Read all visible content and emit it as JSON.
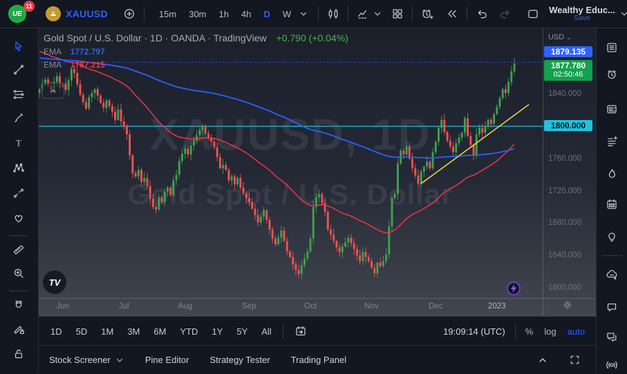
{
  "colors": {
    "accent_blue": "#2962ff",
    "up_green": "#3fa24e",
    "down_red": "#ef5350",
    "ema_fast_red": "#f23645",
    "ema_slow_blue": "#2962ff",
    "trend_yellow": "#e8d34d",
    "level_cyan": "#22c1dd",
    "last_green": "#13a14f"
  },
  "topbar": {
    "badge_count": "11",
    "symbol": "XAUUSD",
    "timeframes": [
      {
        "label": "15m",
        "active": false
      },
      {
        "label": "30m",
        "active": false
      },
      {
        "label": "1h",
        "active": false
      },
      {
        "label": "4h",
        "active": false
      },
      {
        "label": "D",
        "active": true
      },
      {
        "label": "W",
        "active": false
      }
    ],
    "account": {
      "name": "Wealthy Educ...",
      "action": "Save"
    }
  },
  "left_toolbar": {
    "tools": [
      "cursor",
      "trend-line",
      "fib-retracement",
      "brush",
      "text",
      "xabcd-pattern",
      "forecast",
      "emoji",
      "ruler",
      "zoom-in",
      "magnet",
      "drawing-lock",
      "lock"
    ]
  },
  "right_sidebar": {
    "icons": [
      "watchlist",
      "alerts",
      "news",
      "text-notes",
      "hotlists",
      "calendar",
      "ideas",
      "minds",
      "chat",
      "conversations",
      "streams"
    ]
  },
  "chart": {
    "legend": {
      "title": "Gold Spot / U.S. Dollar · 1D · OANDA · TradingView",
      "change": "+0.790 (+0.04%)",
      "ema_rows": [
        {
          "label": "EMA",
          "value": "1772.797"
        },
        {
          "label": "EMA",
          "value": "1787.215"
        }
      ]
    },
    "watermark": {
      "line1": "XAUUSD, 1D",
      "line2": "Gold Spot / U.S. Dollar"
    },
    "price_scale": {
      "currency_label": "USD",
      "alert_label": "1879.135",
      "last_label": "1877.780",
      "countdown": "02:50:46",
      "level_label": "1800.000",
      "ticks": [
        {
          "label": "1840.000",
          "price": 1840
        },
        {
          "label": "1760.000",
          "price": 1760
        },
        {
          "label": "1720.000",
          "price": 1720
        },
        {
          "label": "1680.000",
          "price": 1680
        },
        {
          "label": "1640.000",
          "price": 1640
        },
        {
          "label": "1600.000",
          "price": 1600
        }
      ]
    }
  },
  "chart_data": {
    "type": "candlestick",
    "symbol": "XAUUSD",
    "interval": "1D",
    "title": "Gold Spot / U.S. Dollar",
    "ylim": [
      1587.2,
      1922.2
    ],
    "closes": [
      1846,
      1852,
      1858,
      1850,
      1843,
      1855,
      1862,
      1848,
      1853,
      1845,
      1857,
      1871,
      1866,
      1852,
      1839,
      1830,
      1822,
      1836,
      1841,
      1846,
      1838,
      1829,
      1823,
      1832,
      1825,
      1818,
      1808,
      1821,
      1806,
      1800,
      1790,
      1764,
      1742,
      1738,
      1746,
      1731,
      1736,
      1726,
      1710,
      1700,
      1697,
      1712,
      1706,
      1719,
      1724,
      1715,
      1733,
      1740,
      1757,
      1766,
      1772,
      1765,
      1776,
      1782,
      1789,
      1795,
      1800,
      1791,
      1786,
      1781,
      1774,
      1762,
      1748,
      1752,
      1746,
      1733,
      1738,
      1728,
      1736,
      1724,
      1717,
      1711,
      1706,
      1698,
      1690,
      1681,
      1688,
      1696,
      1684,
      1672,
      1661,
      1654,
      1662,
      1671,
      1658,
      1645,
      1638,
      1629,
      1622,
      1617,
      1628,
      1636,
      1645,
      1661,
      1700,
      1712,
      1716,
      1705,
      1694,
      1672,
      1666,
      1658,
      1650,
      1644,
      1651,
      1656,
      1662,
      1655,
      1648,
      1640,
      1633,
      1644,
      1638,
      1633,
      1625,
      1618,
      1631,
      1627,
      1633,
      1641,
      1676,
      1711,
      1716,
      1754,
      1770,
      1765,
      1775,
      1760,
      1748,
      1739,
      1729,
      1744,
      1750,
      1756,
      1748,
      1768,
      1781,
      1798,
      1808,
      1793,
      1782,
      1775,
      1768,
      1779,
      1786,
      1792,
      1810,
      1788,
      1777,
      1764,
      1790,
      1798,
      1792,
      1800,
      1808,
      1803,
      1815,
      1824,
      1835,
      1846,
      1841,
      1855,
      1868,
      1877.8
    ],
    "month_ticks": [
      {
        "label": "Jun",
        "index": 8
      },
      {
        "label": "Jul",
        "index": 29
      },
      {
        "label": "Aug",
        "index": 50
      },
      {
        "label": "Sep",
        "index": 72
      },
      {
        "label": "Oct",
        "index": 93
      },
      {
        "label": "Nov",
        "index": 114
      },
      {
        "label": "Dec",
        "index": 136
      },
      {
        "label": "2023",
        "index": 157
      }
    ],
    "levels": {
      "horizontal_cyan": 1800,
      "alert_blue_dotted": 1879.135
    },
    "last": {
      "price": 1877.78,
      "change": "+0.790 (+0.04%)",
      "countdown": "02:50:46"
    },
    "emas": [
      {
        "name": "EMA slow",
        "period": 200,
        "seed": 1885,
        "color": "#2962ff",
        "display_value": 1772.797
      },
      {
        "name": "EMA fast",
        "period": 50,
        "seed": 1895,
        "color": "#f23645",
        "display_value": 1787.215
      }
    ],
    "trendline_yellow": {
      "from_index": 131,
      "from_price": 1729,
      "to_index": 168,
      "to_price": 1827
    }
  },
  "range_bar": {
    "ranges": [
      "1D",
      "5D",
      "1M",
      "3M",
      "6M",
      "YTD",
      "1Y",
      "5Y",
      "All"
    ],
    "clock": "19:09:14 (UTC)",
    "percent_label": "%",
    "log_label": "log",
    "auto_label": "auto"
  },
  "bottom_panel": {
    "tabs": [
      "Stock Screener",
      "Pine Editor",
      "Strategy Tester",
      "Trading Panel"
    ]
  }
}
